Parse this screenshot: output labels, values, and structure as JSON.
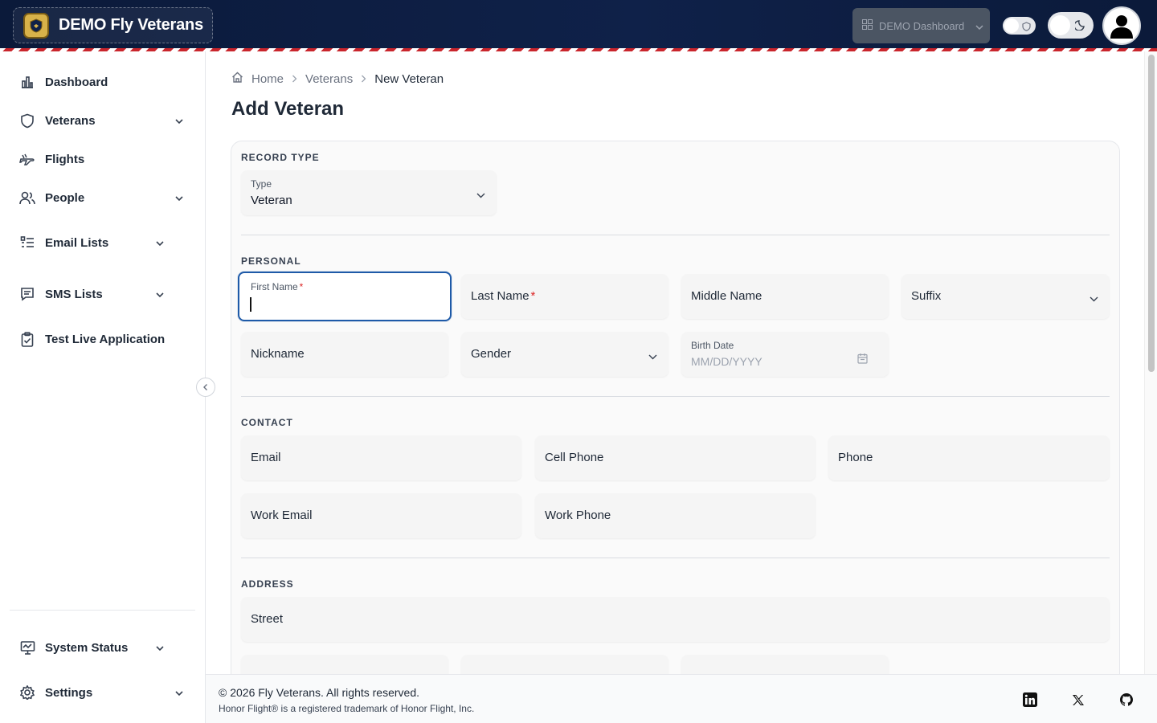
{
  "app": {
    "brand_title": "DEMO Fly Veterans",
    "dashboard_select": "DEMO Dashboard"
  },
  "sidebar": {
    "items": [
      {
        "label": "Dashboard",
        "icon": "bar-chart-icon"
      },
      {
        "label": "Veterans",
        "icon": "shield-icon",
        "expandable": true
      },
      {
        "label": "Flights",
        "icon": "plane-icon"
      },
      {
        "label": "People",
        "icon": "users-icon",
        "expandable": true
      },
      {
        "label": "Email Lists",
        "icon": "list-icon",
        "expandable": true
      },
      {
        "label": "SMS Lists",
        "icon": "message-icon",
        "expandable": true
      },
      {
        "label": "Test Live Application",
        "icon": "clipboard-check-icon"
      }
    ],
    "bottom_items": [
      {
        "label": "System Status",
        "icon": "monitor-icon",
        "expandable": true
      },
      {
        "label": "Settings",
        "icon": "gear-icon",
        "expandable": true
      }
    ]
  },
  "breadcrumb": {
    "home": "Home",
    "section": "Veterans",
    "current": "New Veteran"
  },
  "page": {
    "title": "Add Veteran"
  },
  "form": {
    "record_type": {
      "section_title": "RECORD TYPE",
      "type_label": "Type",
      "type_value": "Veteran"
    },
    "personal": {
      "section_title": "PERSONAL",
      "first_name_label": "First Name",
      "first_name_value": "",
      "last_name_label": "Last Name",
      "middle_name_label": "Middle Name",
      "suffix_label": "Suffix",
      "nickname_label": "Nickname",
      "gender_label": "Gender",
      "birth_date_label": "Birth Date",
      "birth_date_placeholder": "MM/DD/YYYY",
      "required_mark": "*"
    },
    "contact": {
      "section_title": "CONTACT",
      "email_label": "Email",
      "cell_phone_label": "Cell Phone",
      "phone_label": "Phone",
      "work_email_label": "Work Email",
      "work_phone_label": "Work Phone"
    },
    "address": {
      "section_title": "ADDRESS",
      "street_label": "Street"
    }
  },
  "footer": {
    "copyright": "© 2026 Fly Veterans. All rights reserved.",
    "trademark": "Honor Flight® is a registered trademark of Honor Flight, Inc.",
    "social": [
      "linkedin-icon",
      "x-icon",
      "github-icon"
    ]
  },
  "colors": {
    "topbar": "#0b1a3a",
    "stripe_red": "#c9252c",
    "focus_border": "#1e5aa8",
    "required": "#dc2626"
  }
}
